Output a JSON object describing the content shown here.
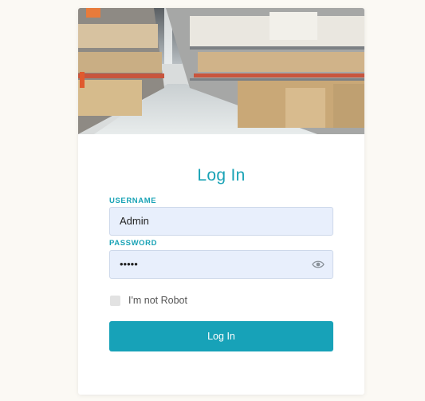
{
  "login": {
    "title": "Log In",
    "username_label": "USERNAME",
    "username_value": "Admin",
    "password_label": "PASSWORD",
    "password_value": "•••••",
    "robot_label": "I'm not Robot",
    "submit_label": "Log In"
  },
  "colors": {
    "accent": "#17a2b8",
    "input_bg": "#e8effc",
    "page_bg": "#fbf9f4"
  },
  "icons": {
    "password_toggle": "eye-icon",
    "hero": "warehouse-image"
  }
}
